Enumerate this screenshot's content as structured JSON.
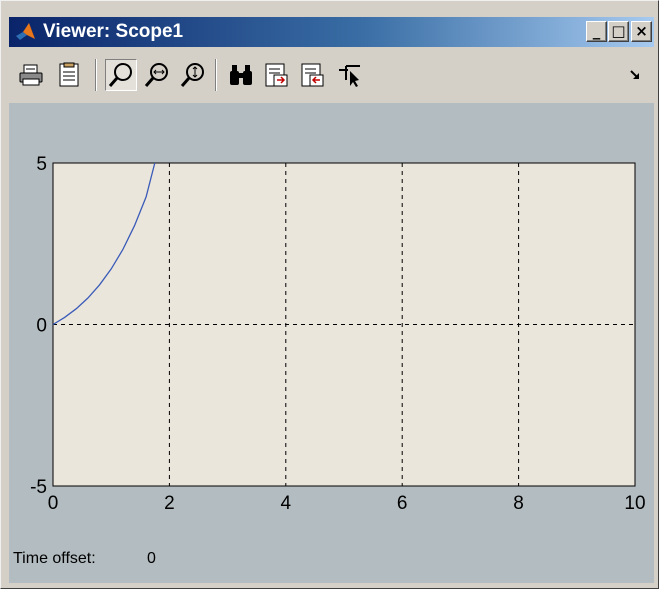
{
  "window": {
    "title": "Viewer: Scope1",
    "minimize_label": "_",
    "maximize_label": "□",
    "close_label": "×"
  },
  "toolbar": {
    "buttons": [
      {
        "name": "print-icon"
      },
      {
        "name": "parameters-icon"
      },
      {
        "name": "zoom-icon",
        "pressed": true
      },
      {
        "name": "zoom-x-icon"
      },
      {
        "name": "zoom-y-icon"
      },
      {
        "name": "autoscale-icon"
      },
      {
        "name": "save-axes-icon"
      },
      {
        "name": "restore-axes-icon"
      },
      {
        "name": "floating-scope-icon"
      }
    ],
    "dock_icon": "dock-arrow-icon"
  },
  "status": {
    "time_offset_label": "Time offset:",
    "time_offset_value": "0"
  },
  "colors": {
    "plot_bg": "#ebe6dc",
    "scope_bg": "#b3bcc0",
    "trace": "#3a5bb8",
    "grid": "#000000"
  },
  "chart_data": {
    "type": "line",
    "title": "",
    "xlabel": "",
    "ylabel": "",
    "xlim": [
      0,
      10
    ],
    "ylim": [
      -5,
      5
    ],
    "x_ticks": [
      "0",
      "2",
      "4",
      "6",
      "8",
      "10"
    ],
    "y_ticks": [
      "5",
      "0",
      "-5"
    ],
    "grid": true,
    "series": [
      {
        "x": [
          0,
          0.2,
          0.4,
          0.6,
          0.8,
          1.0,
          1.2,
          1.4,
          1.6,
          1.75
        ],
        "y": [
          0,
          0.22,
          0.49,
          0.82,
          1.23,
          1.72,
          2.32,
          3.06,
          3.95,
          5.0
        ]
      }
    ]
  }
}
